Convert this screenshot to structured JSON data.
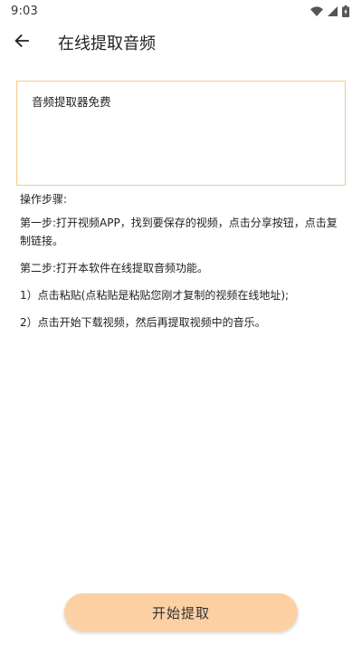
{
  "status_bar": {
    "time": "9:03",
    "icons": [
      "wifi-icon",
      "signal-icon",
      "battery-icon"
    ]
  },
  "app_bar": {
    "back_icon": "arrow-left-icon",
    "title": "在线提取音频"
  },
  "input": {
    "value": "音频提取器免费",
    "border_color": "#f5c98e"
  },
  "instructions": {
    "heading": "操作步骤:",
    "step1": "第一步:打开视频APP，找到要保存的视频，点击分享按钮，点击复制链接。",
    "step2": "第二步:打开本软件在线提取音频功能。",
    "sub1": "1）点击粘贴(点粘贴是粘贴您刚才复制的视频在线地址);",
    "sub2": "2）点击开始下载视频，然后再提取视频中的音乐。"
  },
  "start_button": {
    "label": "开始提取",
    "color": "#fdd0a4"
  }
}
